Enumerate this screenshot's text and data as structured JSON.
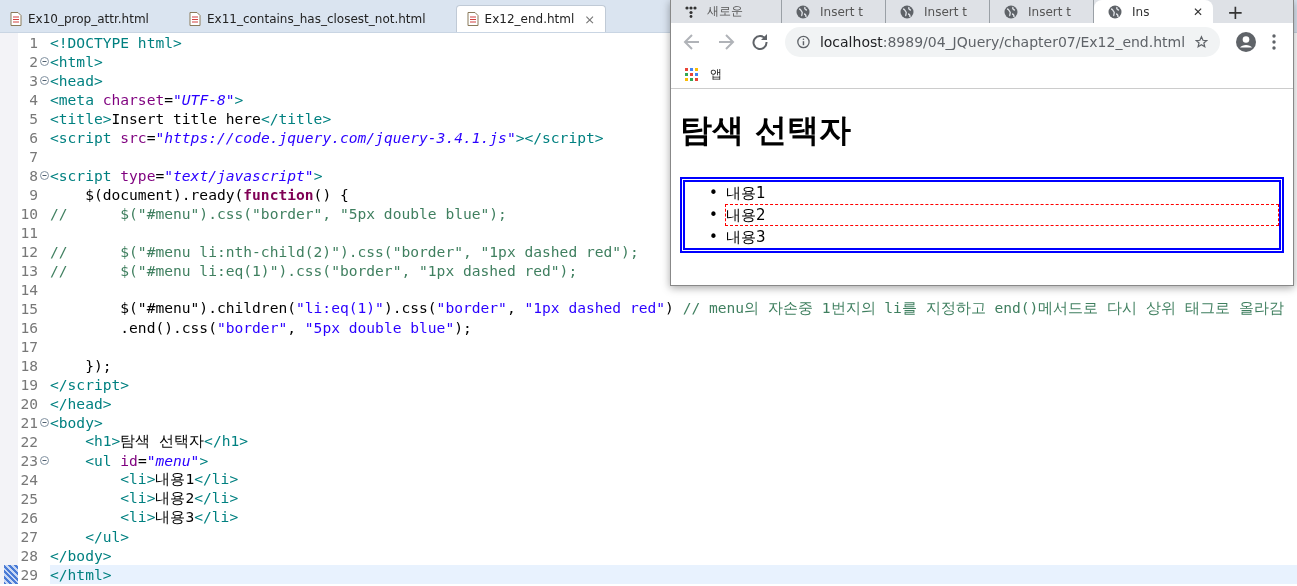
{
  "editor": {
    "tabs": [
      {
        "label": "Ex10_prop_attr.html",
        "selected": false
      },
      {
        "label": "Ex11_contains_has_closest_not.html",
        "selected": false
      },
      {
        "label": "Ex12_end.html",
        "selected": true,
        "close": "⨯"
      }
    ],
    "lines": [
      {
        "number": "1",
        "fold": false,
        "current": false,
        "tokens": [
          {
            "kind": "tag",
            "text": "<!DOCTYPE html>"
          }
        ]
      },
      {
        "number": "2",
        "fold": true,
        "current": false,
        "tokens": [
          {
            "kind": "tag",
            "text": "<html>"
          }
        ]
      },
      {
        "number": "3",
        "fold": true,
        "current": false,
        "tokens": [
          {
            "kind": "tag",
            "text": "<head>"
          }
        ]
      },
      {
        "number": "4",
        "fold": false,
        "current": false,
        "tokens": [
          {
            "kind": "tag",
            "text": "<meta "
          },
          {
            "kind": "attr",
            "text": "charset"
          },
          {
            "kind": "plain",
            "text": "="
          },
          {
            "kind": "value",
            "text": "\"UTF-8\""
          },
          {
            "kind": "tag",
            "text": ">"
          }
        ]
      },
      {
        "number": "5",
        "fold": false,
        "current": false,
        "tokens": [
          {
            "kind": "tag",
            "text": "<title>"
          },
          {
            "kind": "plain",
            "text": "Insert title here"
          },
          {
            "kind": "tag",
            "text": "</title>"
          }
        ]
      },
      {
        "number": "6",
        "fold": false,
        "current": false,
        "tokens": [
          {
            "kind": "tag",
            "text": "<script "
          },
          {
            "kind": "attr",
            "text": "src"
          },
          {
            "kind": "plain",
            "text": "="
          },
          {
            "kind": "value",
            "text": "\"https://code.jquery.com/jquery-3.4.1.js\""
          },
          {
            "kind": "tag",
            "text": "></script>"
          }
        ]
      },
      {
        "number": "7",
        "fold": false,
        "current": false
      },
      {
        "number": "8",
        "fold": true,
        "current": false,
        "tokens": [
          {
            "kind": "tag",
            "text": "<script "
          },
          {
            "kind": "attr",
            "text": "type"
          },
          {
            "kind": "plain",
            "text": "="
          },
          {
            "kind": "value",
            "text": "\"text/javascript\""
          },
          {
            "kind": "tag",
            "text": ">"
          }
        ]
      },
      {
        "number": "9",
        "fold": false,
        "current": false,
        "tokens": [
          {
            "kind": "plain",
            "text": "    $(document).ready("
          },
          {
            "kind": "keyword",
            "text": "function"
          },
          {
            "kind": "plain",
            "text": "() {"
          }
        ]
      },
      {
        "number": "10",
        "fold": false,
        "current": false,
        "tokens": [
          {
            "kind": "comment",
            "text": "//      $(\"#menu\").css(\"border\", \"5px double blue\");"
          }
        ]
      },
      {
        "number": "11",
        "fold": false,
        "current": false
      },
      {
        "number": "12",
        "fold": false,
        "current": false,
        "tokens": [
          {
            "kind": "comment",
            "text": "//      $(\"#menu li:nth-child(2)\").css(\"border\", \"1px dashed red\");"
          }
        ]
      },
      {
        "number": "13",
        "fold": false,
        "current": false,
        "tokens": [
          {
            "kind": "comment",
            "text": "//      $(\"#menu li:eq(1)\").css(\"border\", \"1px dashed red\");"
          }
        ]
      },
      {
        "number": "14",
        "fold": false,
        "current": false
      },
      {
        "number": "15",
        "fold": false,
        "current": false,
        "tokens": [
          {
            "kind": "plain",
            "text": "        $(\"#menu\").children("
          },
          {
            "kind": "string",
            "text": "\"li:eq(1)\""
          },
          {
            "kind": "plain",
            "text": ").css("
          },
          {
            "kind": "string",
            "text": "\"border\""
          },
          {
            "kind": "plain",
            "text": ", "
          },
          {
            "kind": "string",
            "text": "\"1px dashed red\""
          },
          {
            "kind": "plain",
            "text": ") "
          },
          {
            "kind": "comment",
            "text": "// menu의 자손중 1번지의 li를 지정하고 end()메서드로 다시 상위 태그로 올라감"
          }
        ]
      },
      {
        "number": "16",
        "fold": false,
        "current": false,
        "tokens": [
          {
            "kind": "plain",
            "text": "        .end().css("
          },
          {
            "kind": "string",
            "text": "\"border\""
          },
          {
            "kind": "plain",
            "text": ", "
          },
          {
            "kind": "string",
            "text": "\"5px double blue\""
          },
          {
            "kind": "plain",
            "text": ");"
          }
        ]
      },
      {
        "number": "17",
        "fold": false,
        "current": false
      },
      {
        "number": "18",
        "fold": false,
        "current": false,
        "tokens": [
          {
            "kind": "plain",
            "text": "    });"
          }
        ]
      },
      {
        "number": "19",
        "fold": false,
        "current": false,
        "tokens": [
          {
            "kind": "tag",
            "text": "</script>"
          }
        ]
      },
      {
        "number": "20",
        "fold": false,
        "current": false,
        "tokens": [
          {
            "kind": "tag",
            "text": "</head>"
          }
        ]
      },
      {
        "number": "21",
        "fold": true,
        "current": false,
        "tokens": [
          {
            "kind": "tag",
            "text": "<body>"
          }
        ]
      },
      {
        "number": "22",
        "fold": false,
        "current": false,
        "tokens": [
          {
            "kind": "tag",
            "text": "    <h1>"
          },
          {
            "kind": "plain",
            "text": "탐색 선택자"
          },
          {
            "kind": "tag",
            "text": "</h1>"
          }
        ]
      },
      {
        "number": "23",
        "fold": true,
        "current": false,
        "tokens": [
          {
            "kind": "tag",
            "text": "    <ul "
          },
          {
            "kind": "attr",
            "text": "id"
          },
          {
            "kind": "plain",
            "text": "="
          },
          {
            "kind": "value",
            "text": "\"menu\""
          },
          {
            "kind": "tag",
            "text": ">"
          }
        ]
      },
      {
        "number": "24",
        "fold": false,
        "current": false,
        "tokens": [
          {
            "kind": "tag",
            "text": "        <li>"
          },
          {
            "kind": "plain",
            "text": "내용1"
          },
          {
            "kind": "tag",
            "text": "</li>"
          }
        ]
      },
      {
        "number": "25",
        "fold": false,
        "current": false,
        "tokens": [
          {
            "kind": "tag",
            "text": "        <li>"
          },
          {
            "kind": "plain",
            "text": "내용2"
          },
          {
            "kind": "tag",
            "text": "</li>"
          }
        ]
      },
      {
        "number": "26",
        "fold": false,
        "current": false,
        "tokens": [
          {
            "kind": "tag",
            "text": "        <li>"
          },
          {
            "kind": "plain",
            "text": "내용3"
          },
          {
            "kind": "tag",
            "text": "</li>"
          }
        ]
      },
      {
        "number": "27",
        "fold": false,
        "current": false,
        "tokens": [
          {
            "kind": "tag",
            "text": "    </ul>"
          }
        ]
      },
      {
        "number": "28",
        "fold": false,
        "current": false,
        "tokens": [
          {
            "kind": "tag",
            "text": "</body>"
          }
        ]
      },
      {
        "number": "29",
        "fold": false,
        "current": true,
        "tokens": [
          {
            "kind": "tag",
            "text": "</html>"
          }
        ]
      }
    ]
  },
  "browser": {
    "tabs": [
      {
        "label": "새로운",
        "kind": "app",
        "selected": false
      },
      {
        "label": "Insert t",
        "kind": "web",
        "selected": false
      },
      {
        "label": "Insert t",
        "kind": "web",
        "selected": false
      },
      {
        "label": "Insert t",
        "kind": "web",
        "selected": false
      },
      {
        "label": "Ins",
        "kind": "web",
        "selected": true,
        "close": "✕"
      }
    ],
    "new_tab": "+",
    "address": {
      "host": "localhost",
      "path": ":8989/04_JQuery/chapter07/Ex12_end.html"
    },
    "bookmarks": [
      {
        "label": "앱"
      }
    ],
    "page": {
      "heading": "탐색 선택자",
      "list": [
        {
          "marker": "•",
          "text": "내용1",
          "highlighted": false
        },
        {
          "marker": "•",
          "text": "내용2",
          "highlighted": true
        },
        {
          "marker": "•",
          "text": "내용3",
          "highlighted": false
        }
      ]
    }
  }
}
